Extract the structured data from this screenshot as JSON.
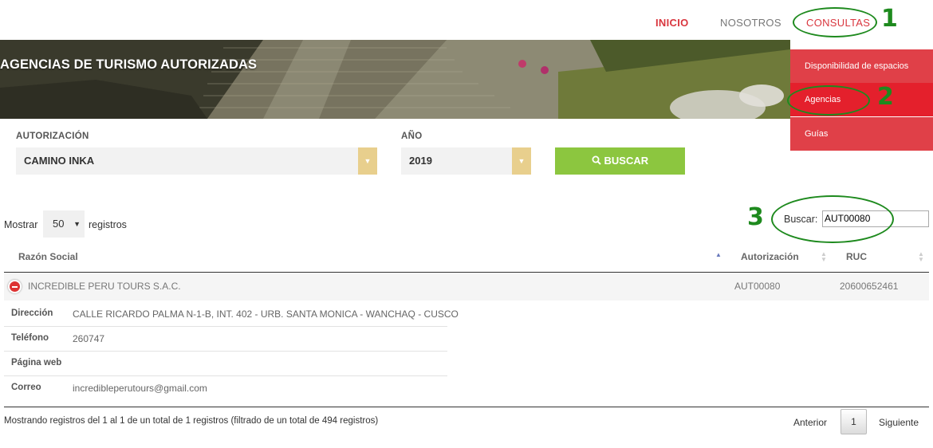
{
  "nav": {
    "inicio": "INICIO",
    "nosotros": "NOSOTROS",
    "consultas": "CONSULTAS"
  },
  "annotations": [
    "1",
    "2",
    "3"
  ],
  "banner": {
    "title": "AGENCIAS DE TURISMO AUTORIZADAS"
  },
  "dropdown": {
    "items": [
      "Disponibilidad de espacios",
      "Agencias",
      "Guías"
    ]
  },
  "form": {
    "autorizacion_label": "AUTORIZACIÓN",
    "autorizacion_value": "CAMINO INKA",
    "anio_label": "AÑO",
    "anio_value": "2019",
    "buscar_button": "BUSCAR"
  },
  "table_controls": {
    "mostrar": "Mostrar",
    "length_value": "50",
    "registros": "registros",
    "buscar_label": "Buscar:",
    "search_value": "AUT00080"
  },
  "table": {
    "headers": [
      "Razón Social",
      "Autorización",
      "RUC"
    ],
    "row": {
      "razon_social": "INCREDIBLE PERU TOURS S.A.C.",
      "autorizacion": "AUT00080",
      "ruc": "20600652461"
    },
    "details": [
      {
        "key": "Dirección",
        "value": "CALLE RICARDO PALMA N-1-B, INT. 402 - URB. SANTA MONICA - WANCHAQ - CUSCO"
      },
      {
        "key": "Teléfono",
        "value": "260747"
      },
      {
        "key": "Página web",
        "value": ""
      },
      {
        "key": "Correo",
        "value": "incredibleperutours@gmail.com"
      }
    ]
  },
  "footer": {
    "info": "Mostrando registros del 1 al 1 de un total de 1 registros (filtrado de un total de 494 registros)",
    "anterior": "Anterior",
    "current_page": "1",
    "siguiente": "Siguiente"
  },
  "colors": {
    "brand_red": "#d9363e",
    "dropdown_bg": "#e04048",
    "dropdown_active": "#e4202c",
    "button_green": "#8cc63f",
    "caret_gold": "#e8cf8d",
    "annotation_green": "#1e8a1e"
  }
}
